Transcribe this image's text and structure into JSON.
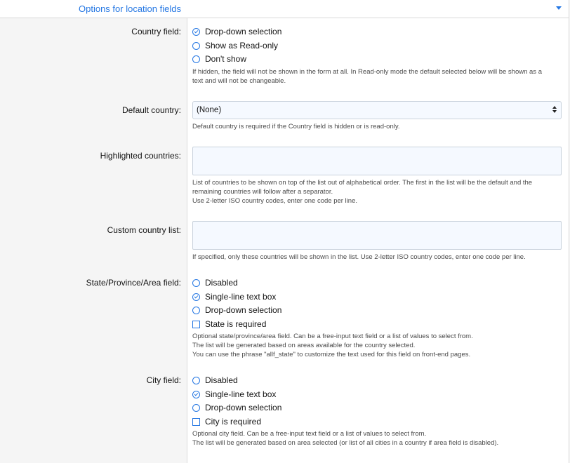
{
  "header": {
    "title": "Options for location fields"
  },
  "country_field": {
    "label": "Country field:",
    "options": [
      "Drop-down selection",
      "Show as Read-only",
      "Don't show"
    ],
    "selected": "Drop-down selection",
    "help": [
      "If hidden, the field will not be shown in the form at all. In Read-only mode the default selected below will be shown as a",
      "text and will not be changeable."
    ]
  },
  "default_country": {
    "label": "Default country:",
    "value": "(None)",
    "help": [
      "Default country is required if the Country field is hidden or is read-only."
    ]
  },
  "highlighted_countries": {
    "label": "Highlighted countries:",
    "value": "",
    "help": [
      "List of countries to be shown on top of the list out of alphabetical order. The first in the list will be the default and the",
      "remaining countries will follow after a separator.",
      "Use 2-letter ISO country codes, enter one code per line."
    ]
  },
  "custom_country_list": {
    "label": "Custom country list:",
    "value": "",
    "help": [
      "If specified, only these countries will be shown in the list. Use 2-letter ISO country codes, enter one code per line."
    ]
  },
  "state_field": {
    "label": "State/Province/Area field:",
    "options": [
      "Disabled",
      "Single-line text box",
      "Drop-down selection"
    ],
    "selected": "Single-line text box",
    "required_label": "State is required",
    "required_checked": false,
    "help": [
      "Optional state/province/area field. Can be a free-input text field or a list of values to select from.",
      "The list will be generated based on areas available for the country selected.",
      "You can use the phrase \"allf_state\" to customize the text used for this field on front-end pages."
    ]
  },
  "city_field": {
    "label": "City field:",
    "options": [
      "Disabled",
      "Single-line text box",
      "Drop-down selection"
    ],
    "selected": "Single-line text box",
    "required_label": "City is required",
    "required_checked": false,
    "help": [
      "Optional city field. Can be a free-input text field or a list of values to select from.",
      "The list will be generated based on area selected (or list of all cities in a country if area field is disabled)."
    ]
  },
  "colors": {
    "accent": "#2577e3",
    "input_bg": "#f5f9ff",
    "panel_bg": "#f5f5f5"
  }
}
